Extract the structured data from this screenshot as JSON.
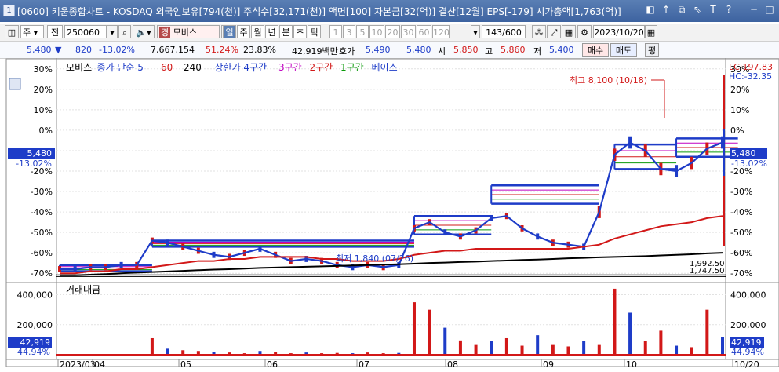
{
  "window": {
    "num": "1",
    "title": "[0600] 키움종합차트 - KOSDAQ 외국인보유[794(천)] 주식수[32,171(천)] 액면[100] 자본금[32(억)] 결산[12월] EPS[-179] 시가총액[1,763(억)]",
    "controls": [
      "◧",
      "↑",
      "⧉",
      "⇖",
      "T",
      "?",
      "─",
      "□",
      "✕"
    ]
  },
  "toolbar": {
    "type_sel": "주",
    "mode_sel": "전",
    "code": "250060",
    "stock_name": "모비스",
    "stock_prefix": "경",
    "periods": [
      "일",
      "주",
      "월",
      "년",
      "분",
      "초",
      "틱"
    ],
    "numbers": [
      "1",
      "3",
      "5",
      "10",
      "20",
      "30",
      "60",
      "120"
    ],
    "count": "143/600",
    "date": "2023/10/20"
  },
  "price_bar": {
    "price": "5,480",
    "change": "820",
    "change_pct": "-13.02%",
    "volume": "7,667,154",
    "pct2": "51.24%",
    "pct3": "23.83%",
    "amount": "42,919백만",
    "hoga_label": "호가",
    "hoga1": "5,490",
    "hoga2": "5,480",
    "open_label": "시",
    "open": "5,850",
    "high_label": "고",
    "high": "5,860",
    "low_label": "저",
    "low": "5,400",
    "buy": "매수",
    "sell": "매도",
    "eval": "평"
  },
  "chart": {
    "legend": {
      "name": "모비스",
      "ma_label": "종가 단순",
      "ma5": "5",
      "ma60": "60",
      "ma240": "240",
      "upper": "상한가 4구간",
      "s3": "3구간",
      "s2": "2구간",
      "s1": "1구간",
      "base": "베이스"
    },
    "right_top1": "LC:197.83",
    "right_top2": "HC:-32.35",
    "price_tag": "5,480",
    "price_tag_pct": "-13.02%",
    "high_note": "최고 8,100 (10/18)",
    "low_note": "최저 1,840 (07/26)",
    "right_lvl1": "1,992.50",
    "right_lvl2": "1,747.50",
    "volume_label": "거래대금",
    "vol_tag": "42,919",
    "vol_tag_pct": "44.94%",
    "x_labels": [
      "2023/03",
      "04",
      "05",
      "06",
      "07",
      "08",
      "09",
      "10",
      "10/20"
    ]
  },
  "chart_data": [
    {
      "type": "line",
      "title": "",
      "y_ticks": [
        "30%",
        "20%",
        "10%",
        "0%",
        "-10%",
        "-20%",
        "-30%",
        "-40%",
        "-50%",
        "-60%",
        "-70%"
      ],
      "ylim": [
        -73,
        33
      ],
      "series": [
        {
          "name": "종가 단순 5",
          "color": "#1e3cc8",
          "values": [
            -68,
            -68,
            -67,
            -67,
            -66,
            -66,
            -54,
            -55,
            -57,
            -59,
            -61,
            -62,
            -60,
            -58,
            -61,
            -64,
            -63,
            -64,
            -66,
            -67,
            -66,
            -67,
            -66,
            -48,
            -45,
            -50,
            -52,
            -49,
            -43,
            -42,
            -48,
            -52,
            -55,
            -56,
            -57,
            -40,
            -12,
            -6,
            -10,
            -19,
            -20,
            -16,
            -9,
            -6
          ]
        },
        {
          "name": "60",
          "color": "#d21818",
          "values": [
            -70,
            -70,
            -69,
            -69,
            -68,
            -68,
            -67,
            -66,
            -65,
            -64,
            -64,
            -63,
            -63,
            -62,
            -62,
            -62,
            -62,
            -63,
            -63,
            -64,
            -64,
            -64,
            -63,
            -61,
            -60,
            -59,
            -59,
            -58,
            -58,
            -58,
            -58,
            -58,
            -58,
            -58,
            -57,
            -56,
            -53,
            -51,
            -49,
            -47,
            -46,
            -45,
            -43,
            -42
          ]
        },
        {
          "name": "240",
          "color": "#000000",
          "values": [
            -71,
            -71,
            -70.7,
            -70.4,
            -70,
            -69.7,
            -69.4,
            -69.1,
            -68.8,
            -68.5,
            -68.2,
            -68,
            -67.7,
            -67.4,
            -67.2,
            -67,
            -66.8,
            -66.6,
            -66.4,
            -66.2,
            -66,
            -65.8,
            -65.6,
            -65.3,
            -65,
            -64.8,
            -64.5,
            -64.3,
            -64,
            -63.8,
            -63.5,
            -63.3,
            -63,
            -62.7,
            -62.5,
            -62.2,
            -62,
            -61.8,
            -61.6,
            -61.3,
            -61,
            -60.7,
            -60.3,
            -60
          ]
        }
      ]
    },
    {
      "type": "bar",
      "title": "",
      "y_ticks": [
        "400,000",
        "200,000"
      ],
      "ylim": [
        0,
        450000
      ],
      "values": [
        20,
        15,
        20,
        30,
        15,
        20,
        110000,
        40000,
        30000,
        25000,
        20000,
        15000,
        10000,
        25000,
        20000,
        10000,
        15000,
        10000,
        12000,
        10000,
        15000,
        10000,
        12000,
        350000,
        300000,
        180000,
        95000,
        70000,
        90000,
        110000,
        60000,
        130000,
        70000,
        55000,
        90000,
        70000,
        440000,
        280000,
        90000,
        160000,
        60000,
        50000,
        300000,
        120000
      ]
    }
  ]
}
